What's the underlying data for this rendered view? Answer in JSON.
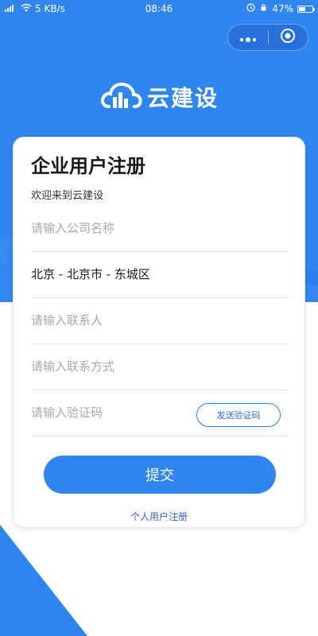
{
  "status_bar": {
    "signal": "⁶ᵢ",
    "speed": "5 KB/s",
    "time": "08:46",
    "battery": "47%",
    "battery_level": 0.47
  },
  "capsule": {
    "more_icon": "more-dots-icon",
    "close_icon": "target-circle-icon"
  },
  "brand": {
    "name": "云建设",
    "logo_icon": "cloud-building-icon",
    "color": "#2f86f0"
  },
  "form": {
    "title": "企业用户注册",
    "subtitle": "欢迎来到云建设",
    "company_placeholder": "请输入公司名称",
    "region_value": "北京 - 北京市 - 东城区",
    "contact_placeholder": "请输入联系人",
    "phone_placeholder": "请输入联系方式",
    "code_placeholder": "请输入验证码",
    "send_code_label": "发送验证码",
    "submit_label": "提交",
    "personal_link": "个人用户注册"
  }
}
